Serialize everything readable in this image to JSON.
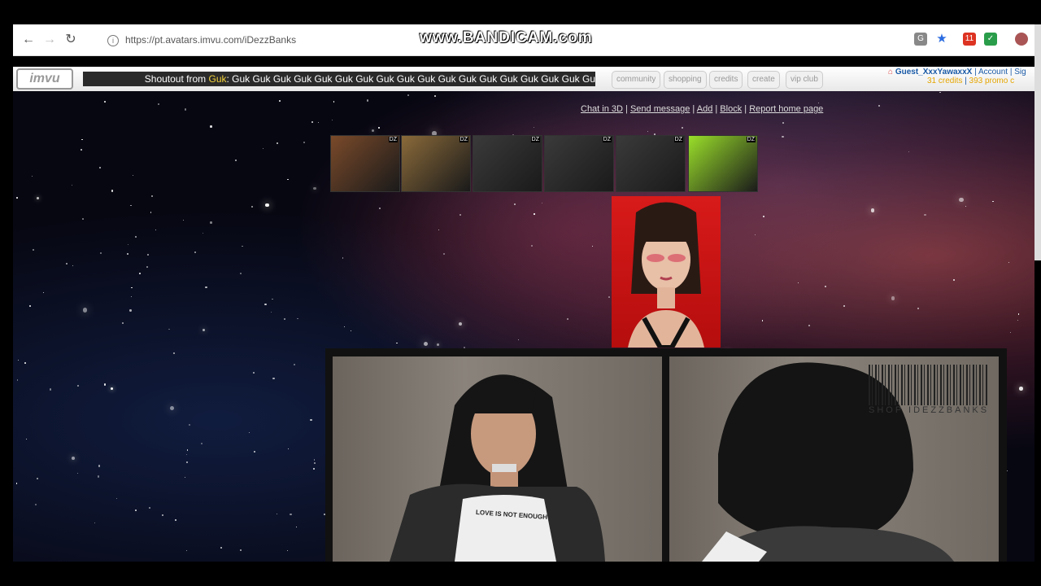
{
  "browser": {
    "url": "https://pt.avatars.imvu.com/iDezzBanks",
    "watermark": "www.BANDICAM.com",
    "ext_badge": "11"
  },
  "imvu_nav": {
    "logo": "imvu",
    "shoutout_prefix": "Shoutout from",
    "shoutout_name": "Guk",
    "shoutout_text": ": Guk Guk Guk Guk Guk Guk Guk Guk Guk Guk Guk Guk Guk Guk Guk Guk Guk Gu",
    "items": [
      "community",
      "shopping",
      "credits",
      "create",
      "vip club"
    ],
    "user": {
      "name": "Guest_XxxYawaxxX",
      "account": "Account",
      "sign": "Sig",
      "credits": "31 credits",
      "promo": "393 promo c"
    }
  },
  "profile_links": [
    "Chat in 3D",
    "Send message",
    "Add",
    "Block",
    "Report home page"
  ],
  "thumbnails": [
    {
      "tag": "DZ",
      "color": "#7a4a2a"
    },
    {
      "tag": "DZ",
      "color": "#8a6a3a"
    },
    {
      "tag": "DZ",
      "color": "#3a3a3a"
    },
    {
      "tag": "DZ",
      "color": "#3a3a3a"
    },
    {
      "tag": "DZ",
      "color": "#3a3a3a"
    },
    {
      "tag": "DZ",
      "color": "#9adf2a"
    }
  ],
  "panel": {
    "shirt_text": "LOVE IS NOT ENOUGH",
    "shop_text": "SHOP IDEZZBANKS"
  }
}
